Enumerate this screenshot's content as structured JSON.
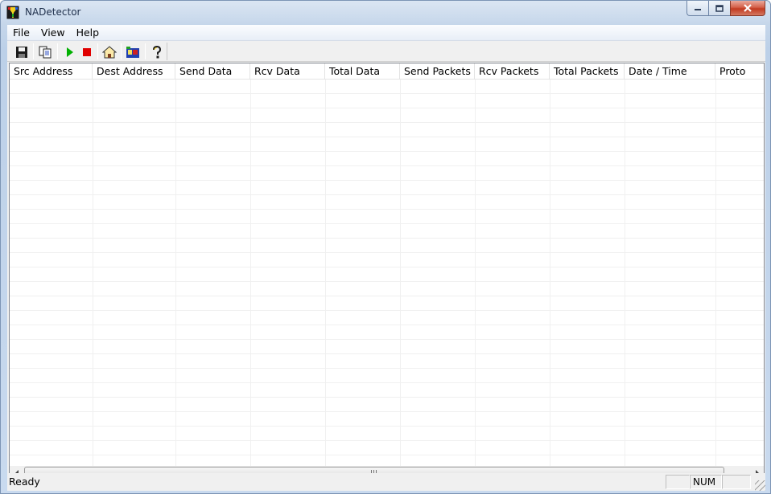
{
  "window": {
    "title": "NADetector",
    "app_icon": "nadetector-app-icon",
    "caption_buttons": [
      "minimize-icon",
      "maximize-icon",
      "close-icon"
    ]
  },
  "menubar": {
    "items": [
      {
        "label": "File"
      },
      {
        "label": "View"
      },
      {
        "label": "Help"
      }
    ]
  },
  "toolbar": {
    "buttons": [
      {
        "icon": "save-icon"
      },
      {
        "icon": "copy-icon"
      },
      {
        "icon": "start-icon",
        "color": "#00b000"
      },
      {
        "icon": "stop-icon",
        "color": "#e00000"
      },
      {
        "icon": "home-icon"
      },
      {
        "icon": "adapter-icon"
      },
      {
        "icon": "help-icon"
      }
    ]
  },
  "listview": {
    "columns": [
      {
        "label": "Src Address"
      },
      {
        "label": "Dest Address"
      },
      {
        "label": "Send Data"
      },
      {
        "label": "Rcv Data"
      },
      {
        "label": "Total Data"
      },
      {
        "label": "Send Packets"
      },
      {
        "label": "Rcv Packets"
      },
      {
        "label": "Total Packets"
      },
      {
        "label": "Date / Time"
      },
      {
        "label": "Proto"
      }
    ],
    "rows": []
  },
  "statusbar": {
    "text": "Ready",
    "panes": [
      "",
      "NUM",
      ""
    ]
  }
}
